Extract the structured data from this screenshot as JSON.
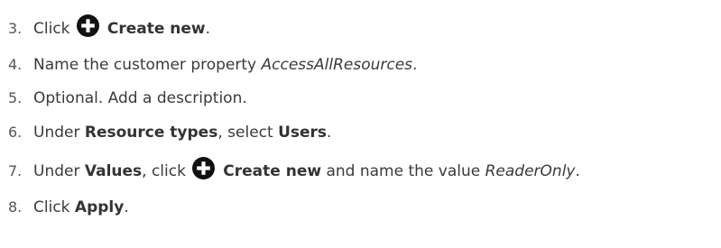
{
  "steps": [
    {
      "number": "3.",
      "parts": [
        {
          "text": "Click ",
          "style": "normal"
        },
        {
          "icon": "plus-circle-icon"
        },
        {
          "text": " Create new",
          "style": "bold"
        },
        {
          "text": ".",
          "style": "normal"
        }
      ]
    },
    {
      "number": "4.",
      "parts": [
        {
          "text": "Name the customer property ",
          "style": "normal"
        },
        {
          "text": "AccessAllResources",
          "style": "italic"
        },
        {
          "text": ".",
          "style": "normal"
        }
      ]
    },
    {
      "number": "5.",
      "parts": [
        {
          "text": "Optional. Add a description.",
          "style": "normal"
        }
      ]
    },
    {
      "number": "6.",
      "parts": [
        {
          "text": "Under ",
          "style": "normal"
        },
        {
          "text": "Resource types",
          "style": "bold"
        },
        {
          "text": ", select ",
          "style": "normal"
        },
        {
          "text": "Users",
          "style": "bold"
        },
        {
          "text": ".",
          "style": "normal"
        }
      ]
    },
    {
      "number": "7.",
      "parts": [
        {
          "text": "Under ",
          "style": "normal"
        },
        {
          "text": "Values",
          "style": "bold"
        },
        {
          "text": ", click ",
          "style": "normal"
        },
        {
          "icon": "plus-circle-icon"
        },
        {
          "text": " Create new",
          "style": "bold"
        },
        {
          "text": " and name the value ",
          "style": "normal"
        },
        {
          "text": "ReaderOnly",
          "style": "italic"
        },
        {
          "text": ".",
          "style": "normal"
        }
      ]
    },
    {
      "number": "8.",
      "parts": [
        {
          "text": "Click ",
          "style": "normal"
        },
        {
          "text": "Apply",
          "style": "bold"
        },
        {
          "text": ".",
          "style": "normal"
        }
      ]
    }
  ]
}
